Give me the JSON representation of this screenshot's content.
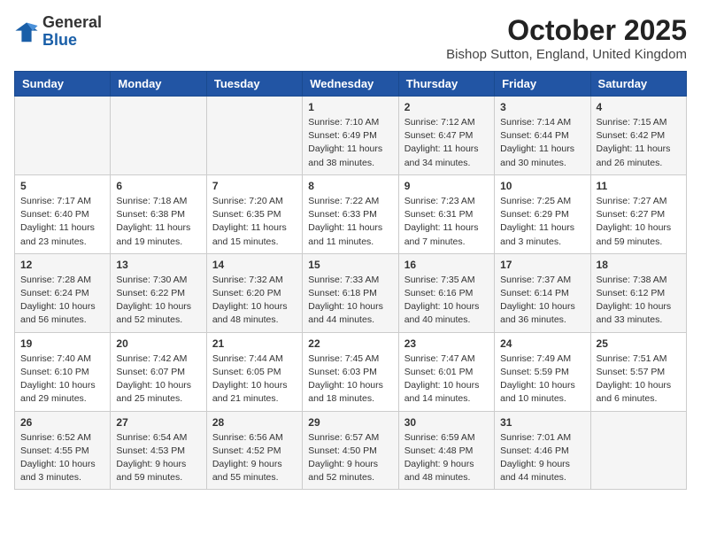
{
  "logo": {
    "general": "General",
    "blue": "Blue"
  },
  "title": {
    "month_year": "October 2025",
    "location": "Bishop Sutton, England, United Kingdom"
  },
  "headers": [
    "Sunday",
    "Monday",
    "Tuesday",
    "Wednesday",
    "Thursday",
    "Friday",
    "Saturday"
  ],
  "weeks": [
    [
      {
        "day": "",
        "info": ""
      },
      {
        "day": "",
        "info": ""
      },
      {
        "day": "",
        "info": ""
      },
      {
        "day": "1",
        "info": "Sunrise: 7:10 AM\nSunset: 6:49 PM\nDaylight: 11 hours\nand 38 minutes."
      },
      {
        "day": "2",
        "info": "Sunrise: 7:12 AM\nSunset: 6:47 PM\nDaylight: 11 hours\nand 34 minutes."
      },
      {
        "day": "3",
        "info": "Sunrise: 7:14 AM\nSunset: 6:44 PM\nDaylight: 11 hours\nand 30 minutes."
      },
      {
        "day": "4",
        "info": "Sunrise: 7:15 AM\nSunset: 6:42 PM\nDaylight: 11 hours\nand 26 minutes."
      }
    ],
    [
      {
        "day": "5",
        "info": "Sunrise: 7:17 AM\nSunset: 6:40 PM\nDaylight: 11 hours\nand 23 minutes."
      },
      {
        "day": "6",
        "info": "Sunrise: 7:18 AM\nSunset: 6:38 PM\nDaylight: 11 hours\nand 19 minutes."
      },
      {
        "day": "7",
        "info": "Sunrise: 7:20 AM\nSunset: 6:35 PM\nDaylight: 11 hours\nand 15 minutes."
      },
      {
        "day": "8",
        "info": "Sunrise: 7:22 AM\nSunset: 6:33 PM\nDaylight: 11 hours\nand 11 minutes."
      },
      {
        "day": "9",
        "info": "Sunrise: 7:23 AM\nSunset: 6:31 PM\nDaylight: 11 hours\nand 7 minutes."
      },
      {
        "day": "10",
        "info": "Sunrise: 7:25 AM\nSunset: 6:29 PM\nDaylight: 11 hours\nand 3 minutes."
      },
      {
        "day": "11",
        "info": "Sunrise: 7:27 AM\nSunset: 6:27 PM\nDaylight: 10 hours\nand 59 minutes."
      }
    ],
    [
      {
        "day": "12",
        "info": "Sunrise: 7:28 AM\nSunset: 6:24 PM\nDaylight: 10 hours\nand 56 minutes."
      },
      {
        "day": "13",
        "info": "Sunrise: 7:30 AM\nSunset: 6:22 PM\nDaylight: 10 hours\nand 52 minutes."
      },
      {
        "day": "14",
        "info": "Sunrise: 7:32 AM\nSunset: 6:20 PM\nDaylight: 10 hours\nand 48 minutes."
      },
      {
        "day": "15",
        "info": "Sunrise: 7:33 AM\nSunset: 6:18 PM\nDaylight: 10 hours\nand 44 minutes."
      },
      {
        "day": "16",
        "info": "Sunrise: 7:35 AM\nSunset: 6:16 PM\nDaylight: 10 hours\nand 40 minutes."
      },
      {
        "day": "17",
        "info": "Sunrise: 7:37 AM\nSunset: 6:14 PM\nDaylight: 10 hours\nand 36 minutes."
      },
      {
        "day": "18",
        "info": "Sunrise: 7:38 AM\nSunset: 6:12 PM\nDaylight: 10 hours\nand 33 minutes."
      }
    ],
    [
      {
        "day": "19",
        "info": "Sunrise: 7:40 AM\nSunset: 6:10 PM\nDaylight: 10 hours\nand 29 minutes."
      },
      {
        "day": "20",
        "info": "Sunrise: 7:42 AM\nSunset: 6:07 PM\nDaylight: 10 hours\nand 25 minutes."
      },
      {
        "day": "21",
        "info": "Sunrise: 7:44 AM\nSunset: 6:05 PM\nDaylight: 10 hours\nand 21 minutes."
      },
      {
        "day": "22",
        "info": "Sunrise: 7:45 AM\nSunset: 6:03 PM\nDaylight: 10 hours\nand 18 minutes."
      },
      {
        "day": "23",
        "info": "Sunrise: 7:47 AM\nSunset: 6:01 PM\nDaylight: 10 hours\nand 14 minutes."
      },
      {
        "day": "24",
        "info": "Sunrise: 7:49 AM\nSunset: 5:59 PM\nDaylight: 10 hours\nand 10 minutes."
      },
      {
        "day": "25",
        "info": "Sunrise: 7:51 AM\nSunset: 5:57 PM\nDaylight: 10 hours\nand 6 minutes."
      }
    ],
    [
      {
        "day": "26",
        "info": "Sunrise: 6:52 AM\nSunset: 4:55 PM\nDaylight: 10 hours\nand 3 minutes."
      },
      {
        "day": "27",
        "info": "Sunrise: 6:54 AM\nSunset: 4:53 PM\nDaylight: 9 hours\nand 59 minutes."
      },
      {
        "day": "28",
        "info": "Sunrise: 6:56 AM\nSunset: 4:52 PM\nDaylight: 9 hours\nand 55 minutes."
      },
      {
        "day": "29",
        "info": "Sunrise: 6:57 AM\nSunset: 4:50 PM\nDaylight: 9 hours\nand 52 minutes."
      },
      {
        "day": "30",
        "info": "Sunrise: 6:59 AM\nSunset: 4:48 PM\nDaylight: 9 hours\nand 48 minutes."
      },
      {
        "day": "31",
        "info": "Sunrise: 7:01 AM\nSunset: 4:46 PM\nDaylight: 9 hours\nand 44 minutes."
      },
      {
        "day": "",
        "info": ""
      }
    ]
  ]
}
